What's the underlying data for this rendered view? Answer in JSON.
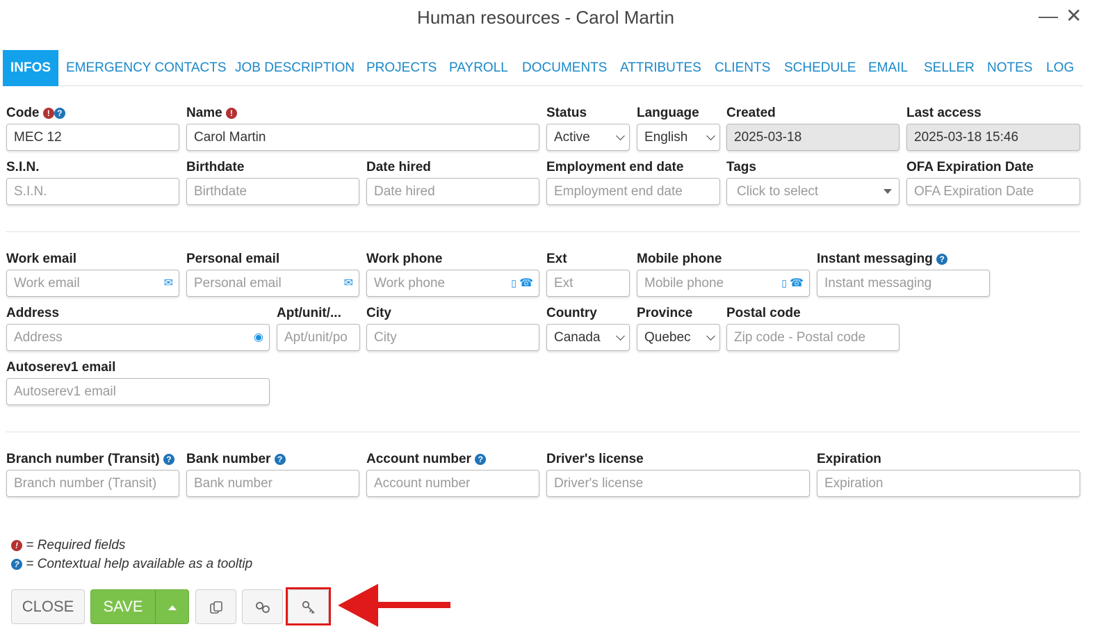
{
  "window": {
    "title": "Human resources - Carol Martin",
    "minimize": "—",
    "close": "✕"
  },
  "tabs": [
    "INFOS",
    "EMERGENCY CONTACTS",
    "JOB DESCRIPTION",
    "PROJECTS",
    "PAYROLL",
    "DOCUMENTS",
    "ATTRIBUTES",
    "CLIENTS",
    "SCHEDULE",
    "EMAIL",
    "SELLER",
    "NOTES",
    "LOG"
  ],
  "fields": {
    "code": {
      "label": "Code",
      "value": "MEC 12"
    },
    "name": {
      "label": "Name",
      "value": "Carol Martin"
    },
    "status": {
      "label": "Status",
      "value": "Active"
    },
    "language": {
      "label": "Language",
      "value": "English"
    },
    "created": {
      "label": "Created",
      "value": "2025-03-18"
    },
    "last_access": {
      "label": "Last access",
      "value": "2025-03-18 15:46"
    },
    "sin": {
      "label": "S.I.N.",
      "placeholder": "S.I.N."
    },
    "birthdate": {
      "label": "Birthdate",
      "placeholder": "Birthdate"
    },
    "date_hired": {
      "label": "Date hired",
      "placeholder": "Date hired"
    },
    "employment_end": {
      "label": "Employment end date",
      "placeholder": "Employment end date"
    },
    "tags": {
      "label": "Tags",
      "placeholder": "Click to select"
    },
    "ofa": {
      "label": "OFA Expiration Date",
      "placeholder": "OFA Expiration Date"
    },
    "work_email": {
      "label": "Work email",
      "placeholder": "Work email"
    },
    "personal_email": {
      "label": "Personal email",
      "placeholder": "Personal email"
    },
    "work_phone": {
      "label": "Work phone",
      "placeholder": "Work phone"
    },
    "ext": {
      "label": "Ext",
      "placeholder": "Ext"
    },
    "mobile_phone": {
      "label": "Mobile phone",
      "placeholder": "Mobile phone"
    },
    "instant_messaging": {
      "label": "Instant messaging",
      "placeholder": "Instant messaging"
    },
    "address": {
      "label": "Address",
      "placeholder": "Address"
    },
    "apt": {
      "label": "Apt/unit/...",
      "placeholder": "Apt/unit/po"
    },
    "city": {
      "label": "City",
      "placeholder": "City"
    },
    "country": {
      "label": "Country",
      "value": "Canada"
    },
    "province": {
      "label": "Province",
      "value": "Quebec"
    },
    "postal": {
      "label": "Postal code",
      "placeholder": "Zip code - Postal code"
    },
    "autoserev_email": {
      "label": "Autoserev1 email",
      "placeholder": "Autoserev1 email"
    },
    "branch": {
      "label": "Branch number (Transit)",
      "placeholder": "Branch number (Transit)"
    },
    "bank": {
      "label": "Bank number",
      "placeholder": "Bank number"
    },
    "account": {
      "label": "Account number",
      "placeholder": "Account number"
    },
    "license": {
      "label": "Driver's license",
      "placeholder": "Driver's license"
    },
    "expiration": {
      "label": "Expiration",
      "placeholder": "Expiration"
    }
  },
  "legend": {
    "required": "= Required fields",
    "help": "= Contextual help available as a tooltip"
  },
  "buttons": {
    "close": "CLOSE",
    "save": "SAVE"
  },
  "colors": {
    "accent": "#13a1ec",
    "save": "#7bc24a",
    "required": "#b33232",
    "help": "#1f74b8",
    "annotation": "#e01a1a"
  }
}
